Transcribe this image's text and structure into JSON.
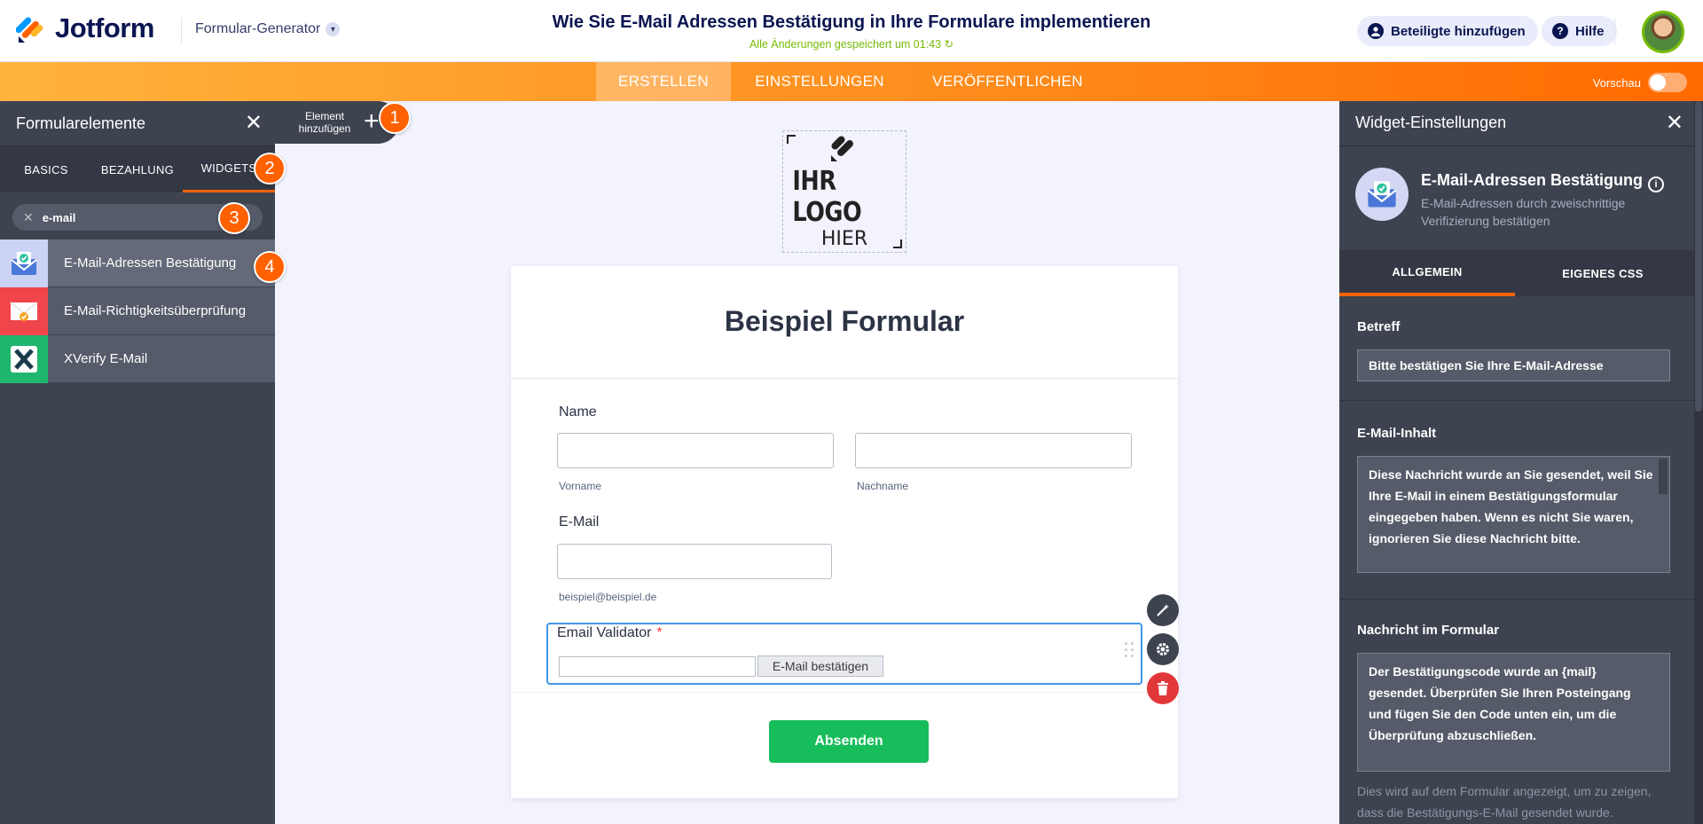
{
  "header": {
    "brand": "Jotform",
    "builder_label": "Formular-Generator",
    "doc_title": "Wie Sie E-Mail Adressen Bestätigung in Ihre Formulare implementieren",
    "saved_status": "Alle Änderungen gespeichert um 01:43",
    "add_participants": "Beteiligte hinzufügen",
    "help": "Hilfe"
  },
  "top_tabs": {
    "create": "ERSTELLEN",
    "settings": "EINSTELLUNGEN",
    "publish": "VERÖFFENTLICHEN",
    "preview": "Vorschau"
  },
  "left_panel": {
    "title": "Formularelemente",
    "tabs": [
      "BASICS",
      "BEZAHLUNG",
      "WIDGETS"
    ],
    "active_tab": "WIDGETS",
    "search_value": "e-mail",
    "add_element": "Element hinzufügen",
    "widgets": [
      {
        "label": "E-Mail-Adressen Bestätigung",
        "selected": true
      },
      {
        "label": "E-Mail-Richtigkeitsüberprüfung",
        "selected": false
      },
      {
        "label": "XVerify E-Mail",
        "selected": false
      }
    ]
  },
  "badges": [
    "1",
    "2",
    "3",
    "4"
  ],
  "canvas": {
    "logo_line1": "IHR LOGO",
    "logo_line2": "HIER",
    "form_title": "Beispiel Formular",
    "name_label": "Name",
    "first_name_sub": "Vorname",
    "last_name_sub": "Nachname",
    "email_label": "E-Mail",
    "email_sub": "beispiel@beispiel.de",
    "validator_label": "Email Validator",
    "required_mark": "*",
    "verify_button": "E-Mail bestätigen",
    "submit": "Absenden"
  },
  "right_panel": {
    "title": "Widget-Einstellungen",
    "widget_name": "E-Mail-Adressen Bestätigung",
    "widget_desc": "E-Mail-Adressen durch zweischrittige Verifizierung bestätigen",
    "tabs": [
      "ALLGEMEIN",
      "EIGENES CSS"
    ],
    "subject_label": "Betreff",
    "subject_value": "Bitte bestätigen Sie Ihre E-Mail-Adresse",
    "content_label": "E-Mail-Inhalt",
    "content_value": "Diese Nachricht wurde an Sie gesendet, weil Sie Ihre E-Mail in einem Bestätigungsformular eingegeben haben. Wenn es nicht Sie waren, ignorieren Sie diese Nachricht bitte.",
    "message_label": "Nachricht im Formular",
    "message_value": "Der Bestätigungscode wurde an {mail} gesendet. Überprüfen Sie Ihren Posteingang und fügen Sie den Code unten ein, um die Überprüfung abzuschließen.",
    "message_hint": "Dies wird auf dem Formular angezeigt, um zu zeigen, dass die Bestätigungs-E-Mail gesendet wurde."
  },
  "colors": {
    "brand_orange": "#ff6100",
    "navy": "#0a1551",
    "panel": "#3e4350",
    "submit_green": "#18bd5b",
    "focus_blue": "#4396e8"
  }
}
